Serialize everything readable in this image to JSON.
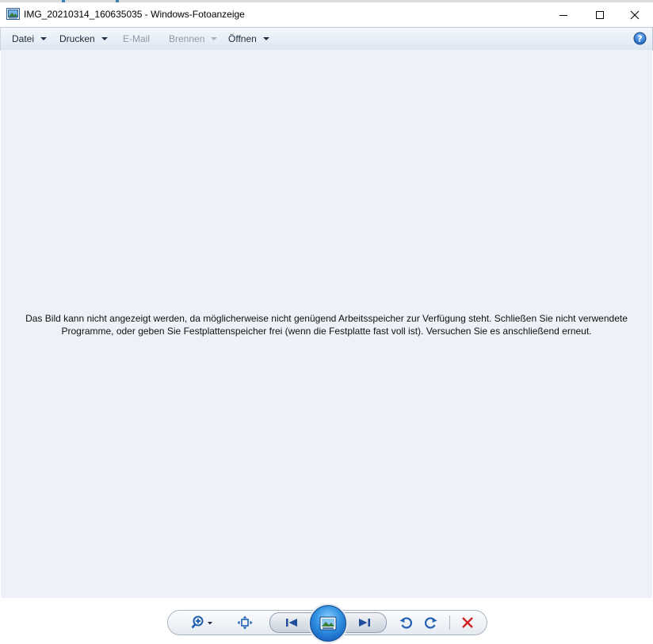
{
  "window": {
    "title": "IMG_20210314_160635035 - Windows-Fotoanzeige",
    "app_icon": "photo-viewer-icon",
    "controls": {
      "minimize": "minimize-icon",
      "maximize": "maximize-icon",
      "close": "close-icon"
    }
  },
  "menu": {
    "datei": "Datei",
    "drucken": "Drucken",
    "email": "E-Mail",
    "brennen": "Brennen",
    "oeffnen": "Öffnen",
    "help_icon": "help-icon",
    "disabled_items": [
      "E-Mail",
      "Brennen"
    ]
  },
  "viewer": {
    "message_line1": "Das Bild kann nicht angezeigt werden, da möglicherweise nicht genügend Arbeitsspeicher zur Verfügung steht. Schließen Sie nicht verwendete",
    "message_line2": "Programme, oder geben Sie Festplattenspeicher frei (wenn die Festplatte fast voll ist). Versuchen Sie es anschließend erneut.",
    "background_color": "#eef2f8"
  },
  "toolbar": {
    "icons": [
      "zoom-icon",
      "fit-to-window-icon",
      "previous-icon",
      "slideshow-icon",
      "next-icon",
      "rotate-left-icon",
      "rotate-right-icon",
      "delete-icon"
    ],
    "accent_color": "#1f6fc7",
    "delete_color": "#d02020"
  }
}
